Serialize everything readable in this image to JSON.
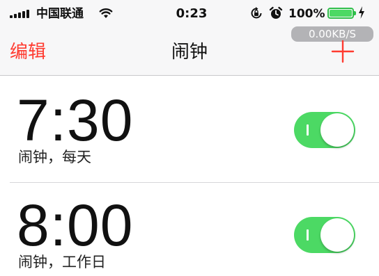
{
  "status_bar": {
    "carrier": "中国联通",
    "time": "0:23",
    "battery_percent": "100%",
    "battery_level": 1.0,
    "signal_bars": 5,
    "icons": [
      "signal-icon",
      "wifi-icon",
      "rotation-lock-icon",
      "alarm-clock-icon",
      "battery-icon",
      "charging-bolt-icon"
    ]
  },
  "speed_badge": "0.00KB/S",
  "nav": {
    "edit_label": "编辑",
    "title": "闹钟",
    "add_icon": "plus-icon"
  },
  "alarms": [
    {
      "time": "7:30",
      "label": "闹钟，每天",
      "enabled": true
    },
    {
      "time": "8:00",
      "label": "闹钟，工作日",
      "enabled": true
    }
  ],
  "colors": {
    "accent": "#ff3b30",
    "toggle_on": "#4cd964",
    "nav_background": "#f7f7f8",
    "speed_badge": "#b3b3b6"
  }
}
